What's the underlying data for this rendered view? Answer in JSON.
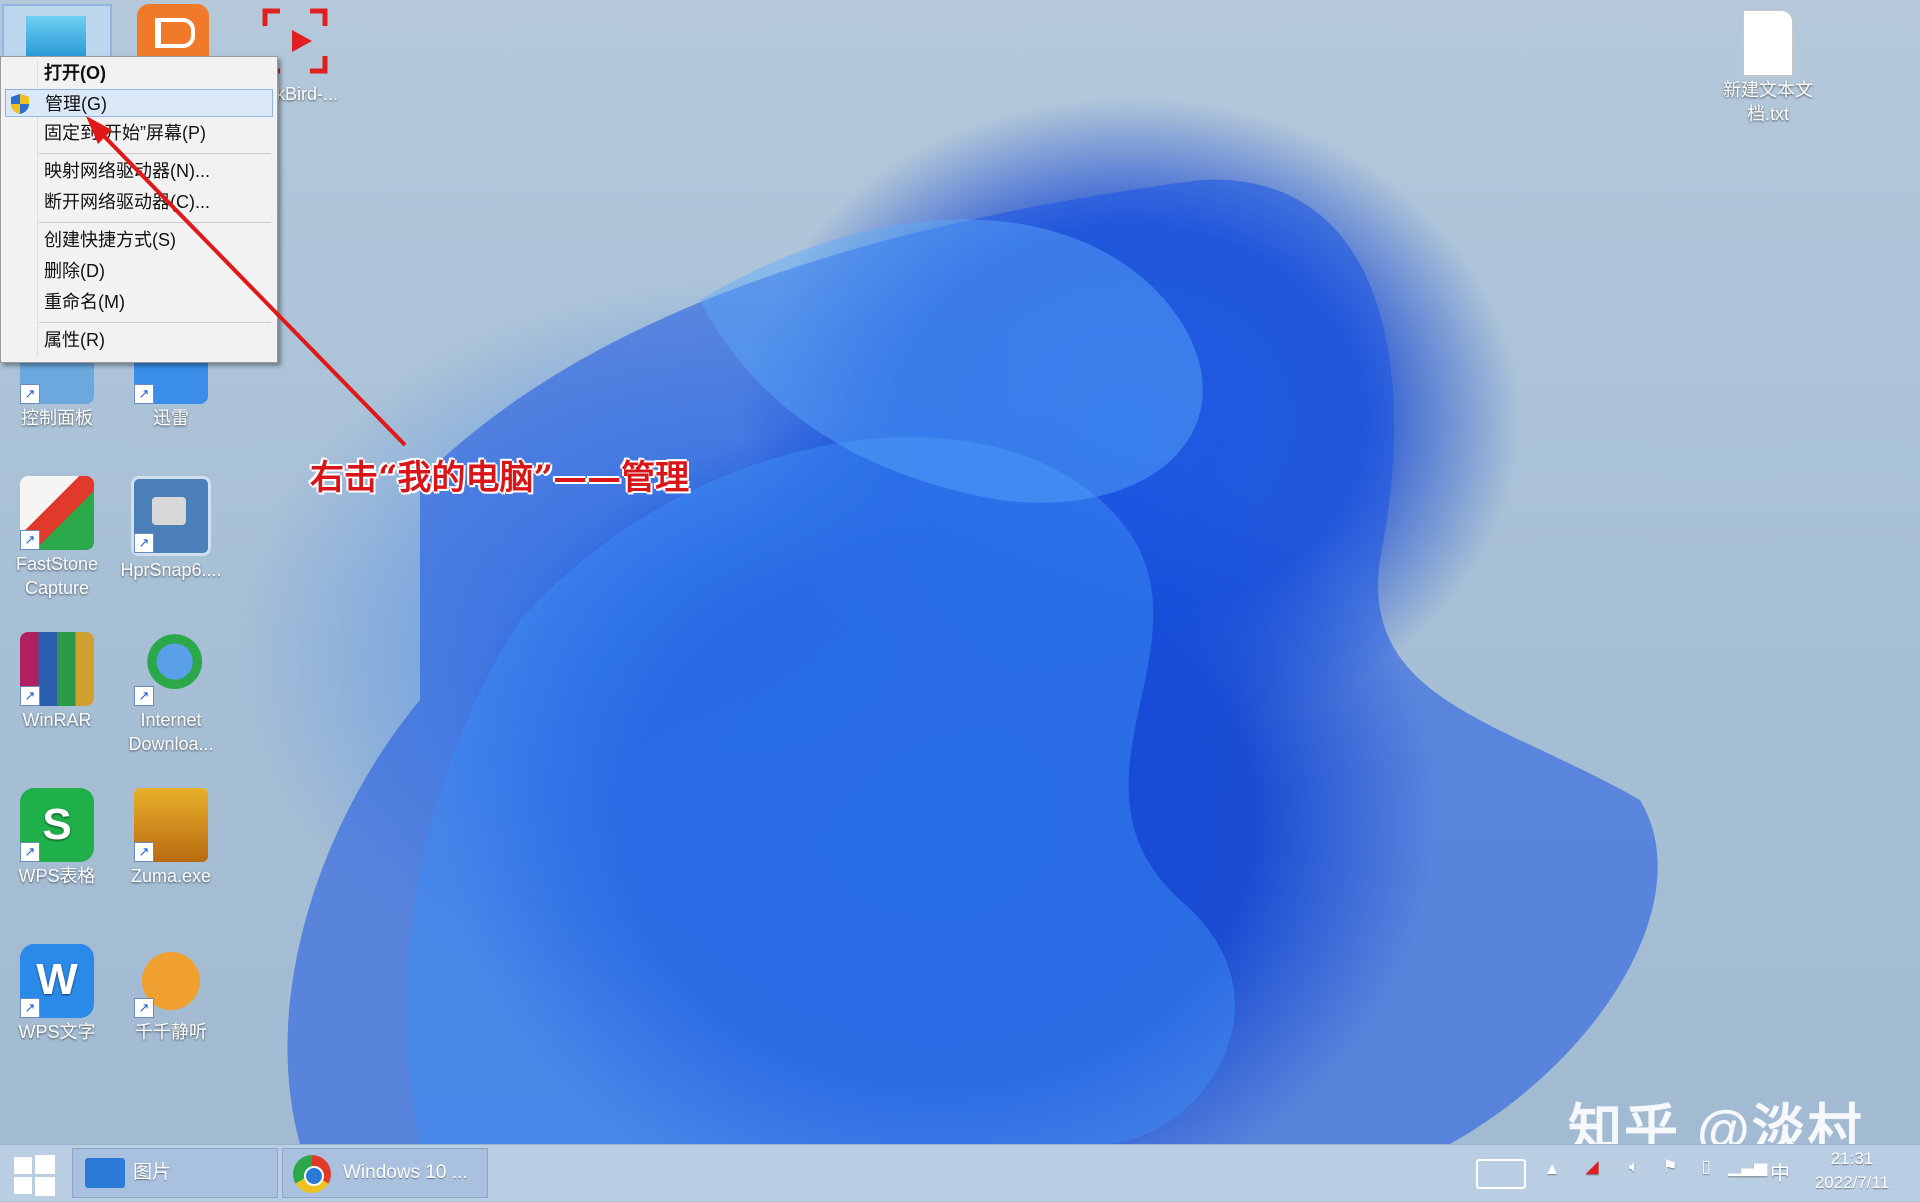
{
  "context_menu": {
    "items": [
      {
        "label": "打开(O)"
      },
      {
        "label": "管理(G)"
      },
      {
        "label": "固定到“开始”屏幕(P)"
      },
      {
        "label": "映射网络驱动器(N)..."
      },
      {
        "label": "断开网络驱动器(C)..."
      },
      {
        "label": "创建快捷方式(S)"
      },
      {
        "label": "删除(D)"
      },
      {
        "label": "重命名(M)"
      },
      {
        "label": "属性(R)"
      }
    ]
  },
  "desktop": {
    "partial_label": "kBird-...",
    "icons": {
      "control_panel": "控制面板",
      "thunder": "迅雷",
      "faststone": "FastStone Capture",
      "hprsnap": "HprSnap6....",
      "winrar": "WinRAR",
      "idm": "Internet Downloa...",
      "wps_sheet": "WPS表格",
      "zuma": "Zuma.exe",
      "wps_writer": "WPS文字",
      "ttplayer": "千千静听",
      "new_txt": "新建文本文档.txt"
    }
  },
  "annotation": "右击“我的电脑”——管理",
  "watermark": "知乎 @淡村",
  "taskbar": {
    "photos_label": "图片",
    "chrome_label": "Windows 10 ...",
    "ime": "中",
    "time": "21:31",
    "date": "2022/7/11"
  },
  "colors": {
    "annotation_red": "#d8161a",
    "menu_highlight": "#dbe8f8",
    "taskbar": "#b9cde3"
  }
}
